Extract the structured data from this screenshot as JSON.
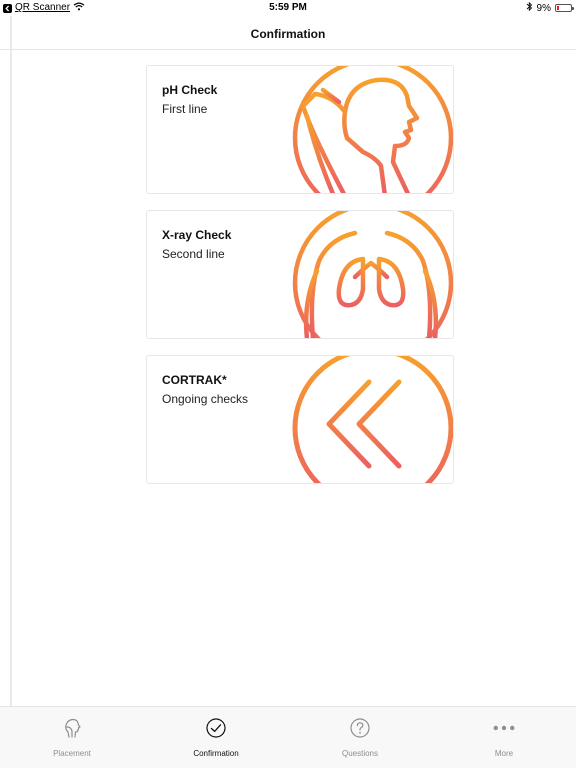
{
  "status_bar": {
    "back_app": "QR Scanner",
    "time": "5:59 PM",
    "battery": "9%"
  },
  "nav": {
    "title": "Confirmation"
  },
  "cards": [
    {
      "title": "pH Check",
      "subtitle": "First line",
      "icon": "head-profile-icon"
    },
    {
      "title": "X-ray Check",
      "subtitle": "Second line",
      "icon": "lungs-icon"
    },
    {
      "title": "CORTRAK*",
      "subtitle": "Ongoing checks",
      "icon": "double-chevron-left-icon"
    }
  ],
  "tabs": [
    {
      "label": "Placement",
      "icon": "head-outline-icon",
      "active": false
    },
    {
      "label": "Confirmation",
      "icon": "check-circle-icon",
      "active": true
    },
    {
      "label": "Questions",
      "icon": "question-circle-icon",
      "active": false
    },
    {
      "label": "More",
      "icon": "more-dots-icon",
      "active": false
    }
  ],
  "colors": {
    "accent_orange": "#f5a623",
    "accent_red": "#ec6161",
    "tab_inactive": "#8e8e8e",
    "tab_active": "#111111"
  }
}
